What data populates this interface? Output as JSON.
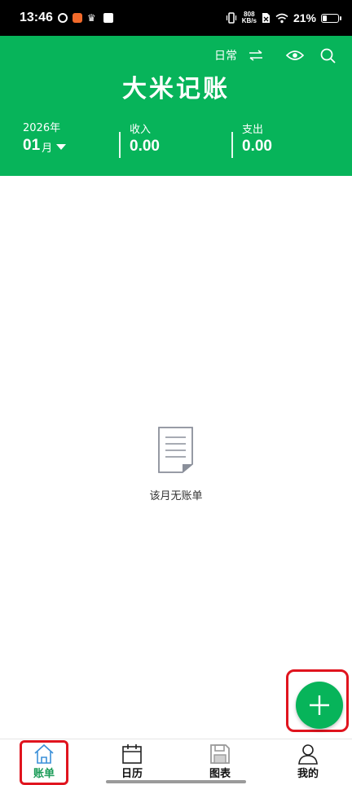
{
  "status_bar": {
    "time": "13:46",
    "net_speed_top": "808",
    "net_speed_bottom": "KB/s",
    "battery": "21%"
  },
  "header": {
    "mode_label": "日常",
    "app_title": "大米记账",
    "year": "2026年",
    "month_number": "01",
    "month_unit": "月",
    "income_label": "收入",
    "income_value": "0.00",
    "expense_label": "支出",
    "expense_value": "0.00"
  },
  "empty_state": {
    "message": "该月无账单"
  },
  "bottom_nav": {
    "items": [
      {
        "label": "账单",
        "icon": "home-icon",
        "active": true
      },
      {
        "label": "日历",
        "icon": "calendar-icon",
        "active": false
      },
      {
        "label": "图表",
        "icon": "chart-icon",
        "active": false
      },
      {
        "label": "我的",
        "icon": "profile-icon",
        "active": false
      }
    ]
  },
  "colors": {
    "brand_green": "#07b45a",
    "highlight_red": "#e0141e",
    "active_tab": "#1a9b57"
  }
}
